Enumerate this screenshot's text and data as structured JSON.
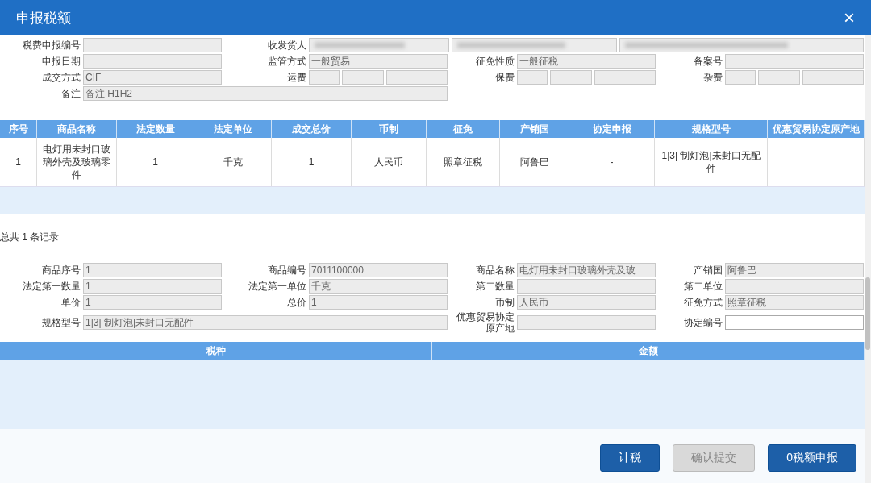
{
  "window": {
    "title": "申报税额",
    "close": "×"
  },
  "header_form": [
    [
      {
        "label": "税费申报编号",
        "kind": "text"
      },
      {
        "label": "收发货人",
        "kind": "party"
      }
    ],
    [
      {
        "label": "申报日期",
        "kind": "text"
      },
      {
        "label": "监管方式",
        "kind": "text",
        "value": "一般贸易"
      },
      {
        "label": "征免性质",
        "kind": "text",
        "value": "一般征税"
      },
      {
        "label": "备案号",
        "kind": "text"
      }
    ],
    [
      {
        "label": "成交方式",
        "kind": "text",
        "value": "CIF"
      },
      {
        "label": "运费",
        "kind": "triple"
      },
      {
        "label": "保费",
        "kind": "triple"
      },
      {
        "label": "杂费",
        "kind": "triple"
      }
    ],
    [
      {
        "label": "备注",
        "kind": "wide",
        "value": "备注 H1H2"
      }
    ]
  ],
  "goods_table": {
    "columns": [
      "序号",
      "商品名称",
      "法定数量",
      "法定单位",
      "成交总价",
      "币制",
      "征免",
      "产销国",
      "协定申报",
      "规格型号",
      "优惠贸易协定原产地"
    ],
    "rows": [
      [
        "1",
        "电灯用未封口玻璃外壳及玻璃零件",
        "1",
        "千克",
        "1",
        "人民币",
        "照章征税",
        "阿鲁巴",
        "-",
        "1|3| 制灯泡|未封口无配件",
        ""
      ]
    ]
  },
  "record_count": "总共 1 条记录",
  "detail_form": [
    [
      {
        "label": "商品序号",
        "kind": "text",
        "value": "1"
      },
      {
        "label": "商品编号",
        "kind": "text",
        "value": "7011100000"
      },
      {
        "label": "商品名称",
        "kind": "text",
        "value": "电灯用未封口玻璃外壳及玻"
      },
      {
        "label": "产销国",
        "kind": "text",
        "value": "阿鲁巴"
      }
    ],
    [
      {
        "label": "法定第一数量",
        "kind": "text",
        "value": "1"
      },
      {
        "label": "法定第一单位",
        "kind": "text",
        "value": "千克"
      },
      {
        "label": "第二数量",
        "kind": "text"
      },
      {
        "label": "第二单位",
        "kind": "text"
      }
    ],
    [
      {
        "label": "单价",
        "kind": "text",
        "value": "1"
      },
      {
        "label": "总价",
        "kind": "text",
        "value": "1"
      },
      {
        "label": "币制",
        "kind": "text",
        "value": "人民币"
      },
      {
        "label": "征免方式",
        "kind": "text",
        "value": "照章征税"
      }
    ],
    [
      {
        "label": "规格型号",
        "kind": "wide",
        "value": "1|3| 制灯泡|未封口无配件"
      },
      {
        "label": "优惠贸易协定原产地",
        "kind": "text"
      },
      {
        "label": "协定编号",
        "kind": "input"
      }
    ]
  ],
  "tax_table": {
    "columns": [
      "税种",
      "金额"
    ]
  },
  "buttons": [
    {
      "label": "计税",
      "disabled": false
    },
    {
      "label": "确认提交",
      "disabled": true
    },
    {
      "label": "0税额申报",
      "disabled": false
    }
  ]
}
